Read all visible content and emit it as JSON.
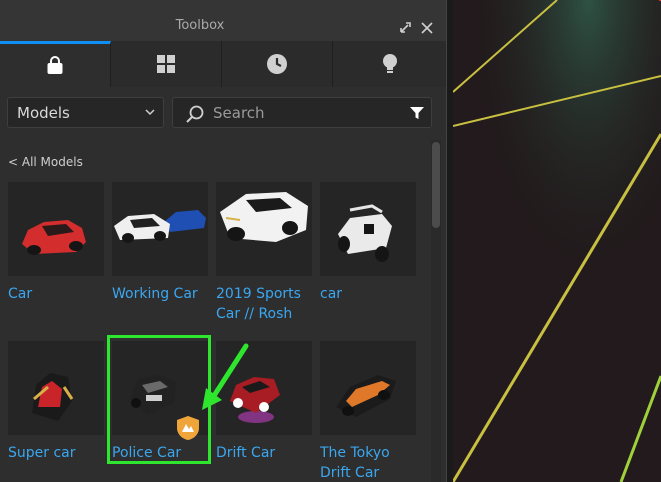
{
  "toolbox": {
    "title": "Toolbox",
    "tabs": [
      {
        "icon": "shopping-bag-icon",
        "active": true
      },
      {
        "icon": "grid-icon",
        "active": false
      },
      {
        "icon": "clock-icon",
        "active": false
      },
      {
        "icon": "lightbulb-icon",
        "active": false
      }
    ],
    "category": "Models",
    "search": {
      "placeholder": "Search",
      "value": ""
    },
    "back_label": "< All Models",
    "items": [
      {
        "label": "Car"
      },
      {
        "label": "Working Car"
      },
      {
        "label": "2019 Sports Car // Rosh"
      },
      {
        "label": "car"
      },
      {
        "label": "Super car"
      },
      {
        "label": "Police Car",
        "highlighted": true,
        "verified_badge": true
      },
      {
        "label": "Drift Car"
      },
      {
        "label": "The Tokyo Drift Car"
      }
    ]
  },
  "colors": {
    "accent_tab": "#0f8ff3",
    "link": "#3aa7f0",
    "highlight": "#2ee62e",
    "badge": "#f0a53a"
  }
}
